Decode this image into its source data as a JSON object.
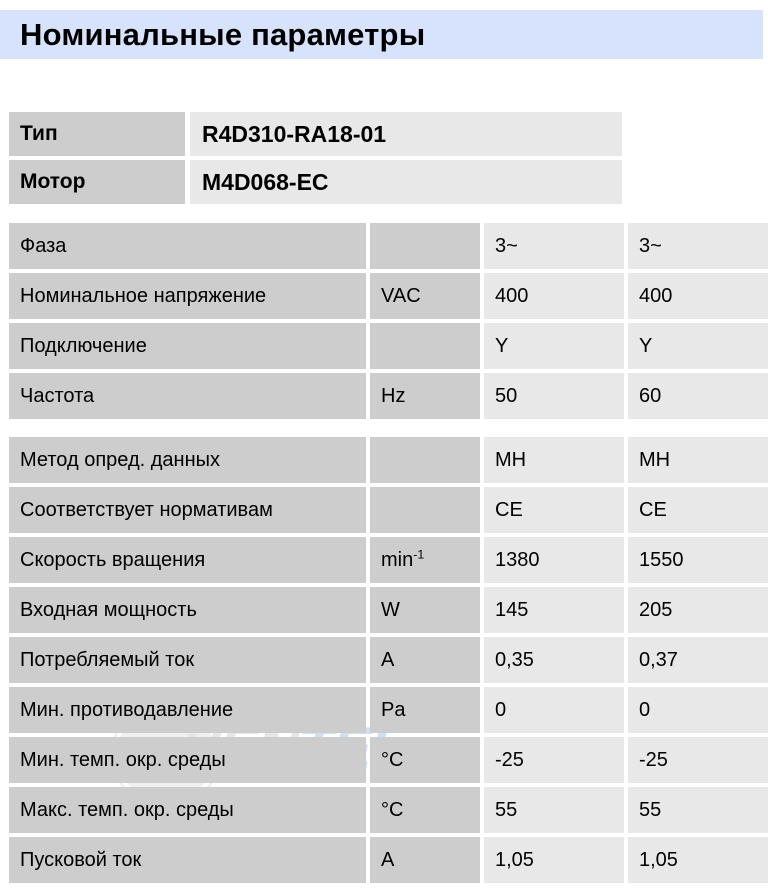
{
  "page": {
    "title": "Номинальные параметры",
    "banner_color": "#d7e3fc",
    "label_cell_color": "#cdcdcd",
    "value_cell_color": "#e8e8e8"
  },
  "watermark": {
    "text_part1": "VEN",
    "text_part2": "TEL",
    "icon": "fan-impeller-icon"
  },
  "identity": [
    {
      "key": "Тип",
      "value": "R4D310-RA18-01"
    },
    {
      "key": "Мотор",
      "value": "M4D068-EC"
    }
  ],
  "table": {
    "groups": [
      {
        "rows": [
          {
            "label": "Фаза",
            "unit": "",
            "v1": "3~",
            "v2": "3~"
          },
          {
            "label": "Номинальное напряжение",
            "unit": "VAC",
            "v1": "400",
            "v2": "400"
          },
          {
            "label": "Подключение",
            "unit": "",
            "v1": "Y",
            "v2": "Y"
          },
          {
            "label": "Частота",
            "unit": "Hz",
            "v1": "50",
            "v2": "60"
          }
        ]
      },
      {
        "rows": [
          {
            "label": "Метод опред. данных",
            "unit": "",
            "unit_sup": "",
            "v1": "MH",
            "v2": "MH"
          },
          {
            "label": "Соответствует нормативам",
            "unit": "",
            "unit_sup": "",
            "v1": "CE",
            "v2": "CE"
          },
          {
            "label": "Скорость вращения",
            "unit": "min",
            "unit_sup": "-1",
            "v1": "1380",
            "v2": "1550"
          },
          {
            "label": "Входная мощность",
            "unit": "W",
            "unit_sup": "",
            "v1": "145",
            "v2": "205"
          },
          {
            "label": "Потребляемый ток",
            "unit": "A",
            "unit_sup": "",
            "v1": "0,35",
            "v2": "0,37"
          },
          {
            "label": "Мин. противодавление",
            "unit": "Pa",
            "unit_sup": "",
            "v1": "0",
            "v2": "0"
          },
          {
            "label": "Мин. темп. окр. среды",
            "unit": "°C",
            "unit_sup": "",
            "v1": "-25",
            "v2": "-25"
          },
          {
            "label": "Макс. темп. окр. среды",
            "unit": "°C",
            "unit_sup": "",
            "v1": "55",
            "v2": "55"
          },
          {
            "label": "Пусковой ток",
            "unit": "A",
            "unit_sup": "",
            "v1": "1,05",
            "v2": "1,05"
          }
        ]
      }
    ]
  }
}
